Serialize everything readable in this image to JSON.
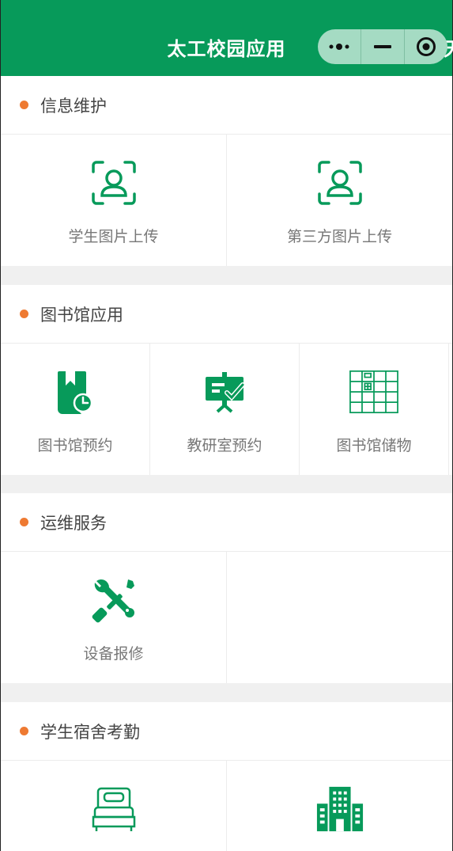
{
  "header": {
    "title": "太工校园应用",
    "overflow_text": "天"
  },
  "capsule": {
    "more_icon": "more-dots-icon",
    "minimize_icon": "minimize-icon",
    "close_icon": "target-close-icon"
  },
  "sections": [
    {
      "title": "信息维护",
      "items": [
        {
          "label": "学生图片上传",
          "icon": "face-scan-icon"
        },
        {
          "label": "第三方图片上传",
          "icon": "face-scan-icon"
        }
      ]
    },
    {
      "title": "图书馆应用",
      "items": [
        {
          "label": "图书馆预约",
          "icon": "book-clock-icon"
        },
        {
          "label": "教研室预约",
          "icon": "presentation-board-icon"
        },
        {
          "label": "图书馆储物",
          "icon": "locker-grid-icon"
        }
      ]
    },
    {
      "title": "运维服务",
      "items": [
        {
          "label": "设备报修",
          "icon": "wrench-screwdriver-icon"
        }
      ]
    },
    {
      "title": "学生宿舍考勤",
      "items": [
        {
          "label": "",
          "icon": "bed-icon"
        },
        {
          "label": "",
          "icon": "building-icon"
        }
      ]
    }
  ],
  "colors": {
    "brand": "#079a5a",
    "dot": "#ee7a32",
    "capsule": "#a5dbc3"
  }
}
